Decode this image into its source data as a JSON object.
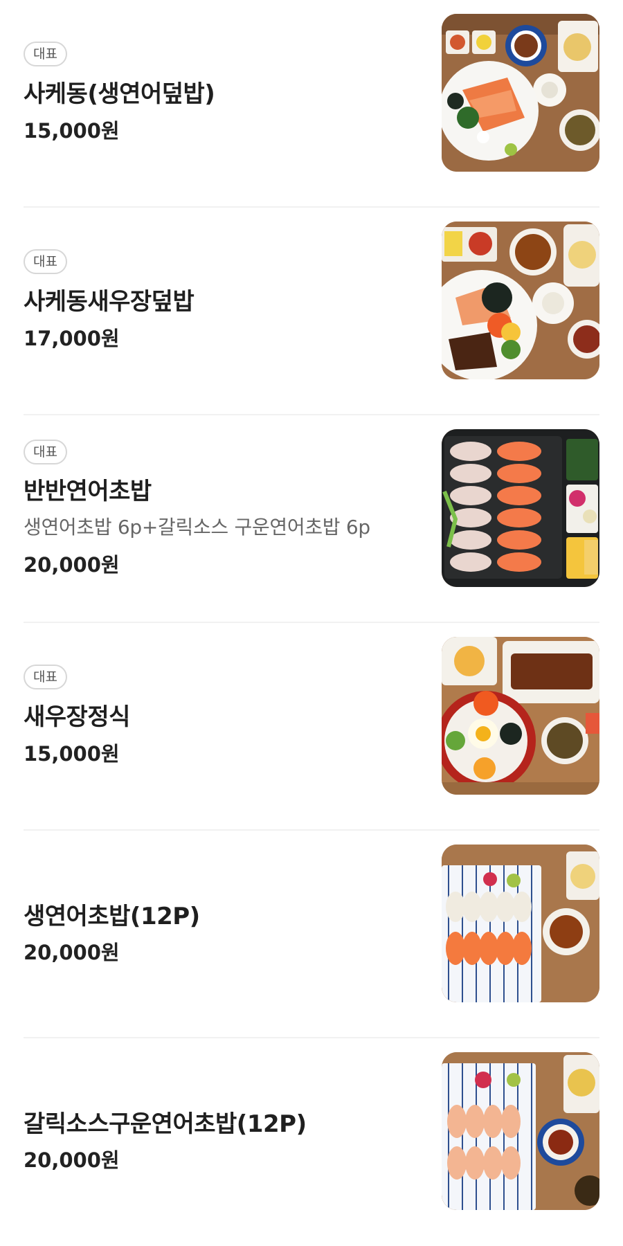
{
  "menu": {
    "items": [
      {
        "badge": "대표",
        "name": "사케동(생연어덮밥)",
        "price": "15,000원",
        "image": "salmon-rice-bowl-photo"
      },
      {
        "badge": "대표",
        "name": "사케동새우장덮밥",
        "price": "17,000원",
        "image": "salmon-shrimp-rice-bowl-photo"
      },
      {
        "badge": "대표",
        "name": "반반연어초밥",
        "description": "생연어초밥 6p+갈릭소스 구운연어초밥 6p",
        "price": "20,000원",
        "image": "half-half-salmon-sushi-photo"
      },
      {
        "badge": "대표",
        "name": "새우장정식",
        "price": "15,000원",
        "image": "marinated-shrimp-set-photo"
      },
      {
        "name": "생연어초밥(12P)",
        "price": "20,000원",
        "image": "salmon-sushi-photo"
      },
      {
        "name": "갈릭소스구운연어초밥(12P)",
        "price": "20,000원",
        "image": "garlic-seared-salmon-sushi-photo"
      }
    ]
  }
}
